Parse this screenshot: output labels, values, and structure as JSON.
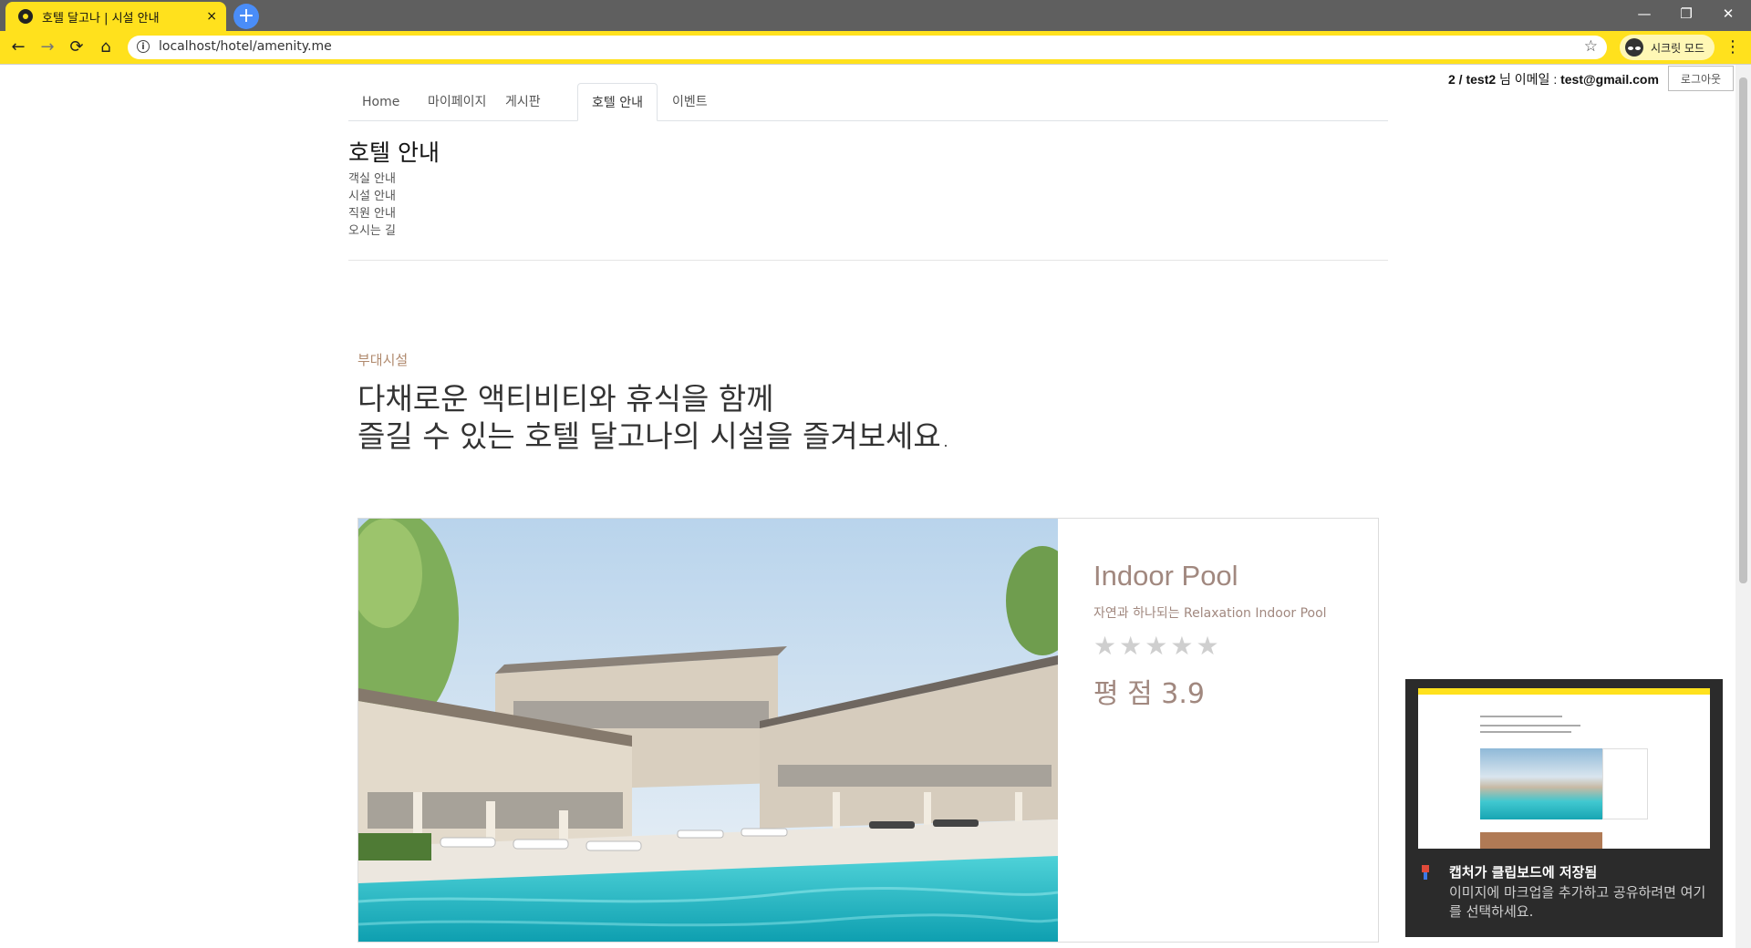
{
  "browser": {
    "tab_title": "호텔 달고나 | 시설 안내",
    "tab_close": "×",
    "new_tab": "+",
    "url": "localhost/hotel/amenity.me",
    "profile_label": "시크릿 모드",
    "window_controls": {
      "minimize": "—",
      "restore": "❐",
      "close": "✕"
    },
    "nav_icons": {
      "back": "←",
      "forward": "→",
      "reload": "⟳",
      "home": "⌂",
      "star": "☆",
      "menu": "⋮",
      "info": "i"
    }
  },
  "user": {
    "info": "2 / test2",
    "info_suffix": " 님 이메일 : ",
    "email": "test@gmail.com",
    "logout": "로그아웃"
  },
  "nav": {
    "tabs": [
      {
        "label": "Home"
      },
      {
        "label": "마이페이지"
      },
      {
        "label": "게시판"
      },
      {
        "label": "호텔 안내"
      },
      {
        "label": "이벤트"
      }
    ],
    "active_index": 3
  },
  "section": {
    "title": "호텔 안내",
    "submenu": [
      "객실 안내",
      "시설 안내",
      "직원 안내",
      "오시는 길"
    ]
  },
  "hero": {
    "eyebrow": "부대시설",
    "headline_line1": "다채로운 액티비티와 휴식을 함께",
    "headline_line2": "즐길 수 있는 호텔 달고나의 시설을 즐겨보세요."
  },
  "amenity": {
    "name": "Indoor Pool",
    "subtitle": "자연과 하나되는 Relaxation Indoor Pool",
    "stars": [
      "★",
      "★",
      "★",
      "★",
      "★"
    ],
    "rating_label": "평 점 3.9",
    "rating_value": 3.9
  },
  "toast": {
    "title": "캡처가 클립보드에 저장됨",
    "body": "이미지에 마크업을 추가하고 공유하려면 여기를 선택하세요."
  },
  "colors": {
    "chrome_accent": "#ffe11d",
    "tabstrip": "#5f5f5f",
    "brand_brown": "#a1887f",
    "eyebrow": "#b08a6e",
    "toast_bg": "#2b2b2b"
  }
}
